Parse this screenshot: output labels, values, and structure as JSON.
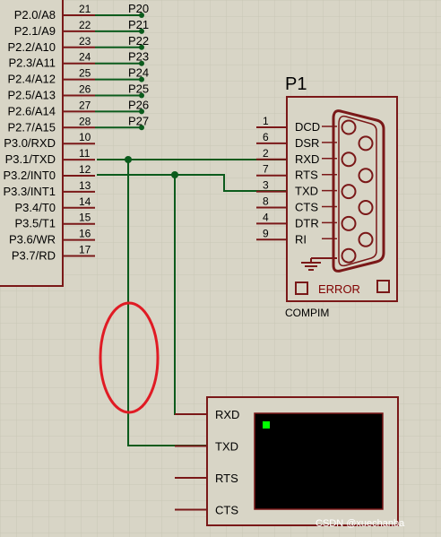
{
  "mcu": {
    "pins": [
      {
        "label": "P2.0/A8",
        "num": "21",
        "net": "P20"
      },
      {
        "label": "P2.1/A9",
        "num": "22",
        "net": "P21"
      },
      {
        "label": "P2.2/A10",
        "num": "23",
        "net": "P22"
      },
      {
        "label": "P2.3/A11",
        "num": "24",
        "net": "P23"
      },
      {
        "label": "P2.4/A12",
        "num": "25",
        "net": "P24"
      },
      {
        "label": "P2.5/A13",
        "num": "26",
        "net": "P25"
      },
      {
        "label": "P2.6/A14",
        "num": "27",
        "net": "P26"
      },
      {
        "label": "P2.7/A15",
        "num": "28",
        "net": "P27"
      },
      {
        "label": "P3.0/RXD",
        "num": "10"
      },
      {
        "label": "P3.1/TXD",
        "num": "11"
      },
      {
        "label": "P3.2/INT0",
        "num": "12"
      },
      {
        "label": "P3.3/INT1",
        "num": "13"
      },
      {
        "label": "P3.4/T0",
        "num": "14"
      },
      {
        "label": "P3.5/T1",
        "num": "15"
      },
      {
        "label": "P3.6/WR",
        "num": "16"
      },
      {
        "label": "P3.7/RD",
        "num": "17"
      }
    ]
  },
  "compim": {
    "ref": "P1",
    "name": "COMPIM",
    "error_label": "ERROR",
    "pins": [
      {
        "label": "DCD",
        "num": "1"
      },
      {
        "label": "DSR",
        "num": "6"
      },
      {
        "label": "RXD",
        "num": "2"
      },
      {
        "label": "RTS",
        "num": "7"
      },
      {
        "label": "TXD",
        "num": "3"
      },
      {
        "label": "CTS",
        "num": "8"
      },
      {
        "label": "DTR",
        "num": "4"
      },
      {
        "label": "RI",
        "num": "9"
      }
    ]
  },
  "terminal": {
    "pins": [
      "RXD",
      "TXD",
      "RTS",
      "CTS"
    ]
  },
  "watermark": "CSDN @xuechanba",
  "colors": {
    "background": "#d8d5c6",
    "wire": "#0b5b1c",
    "component_border": "#7a1818",
    "component_fill": "#d8d5c6",
    "highlight_ellipse": "#e01b24",
    "screen": "#000000",
    "cursor": "#00ff00"
  }
}
